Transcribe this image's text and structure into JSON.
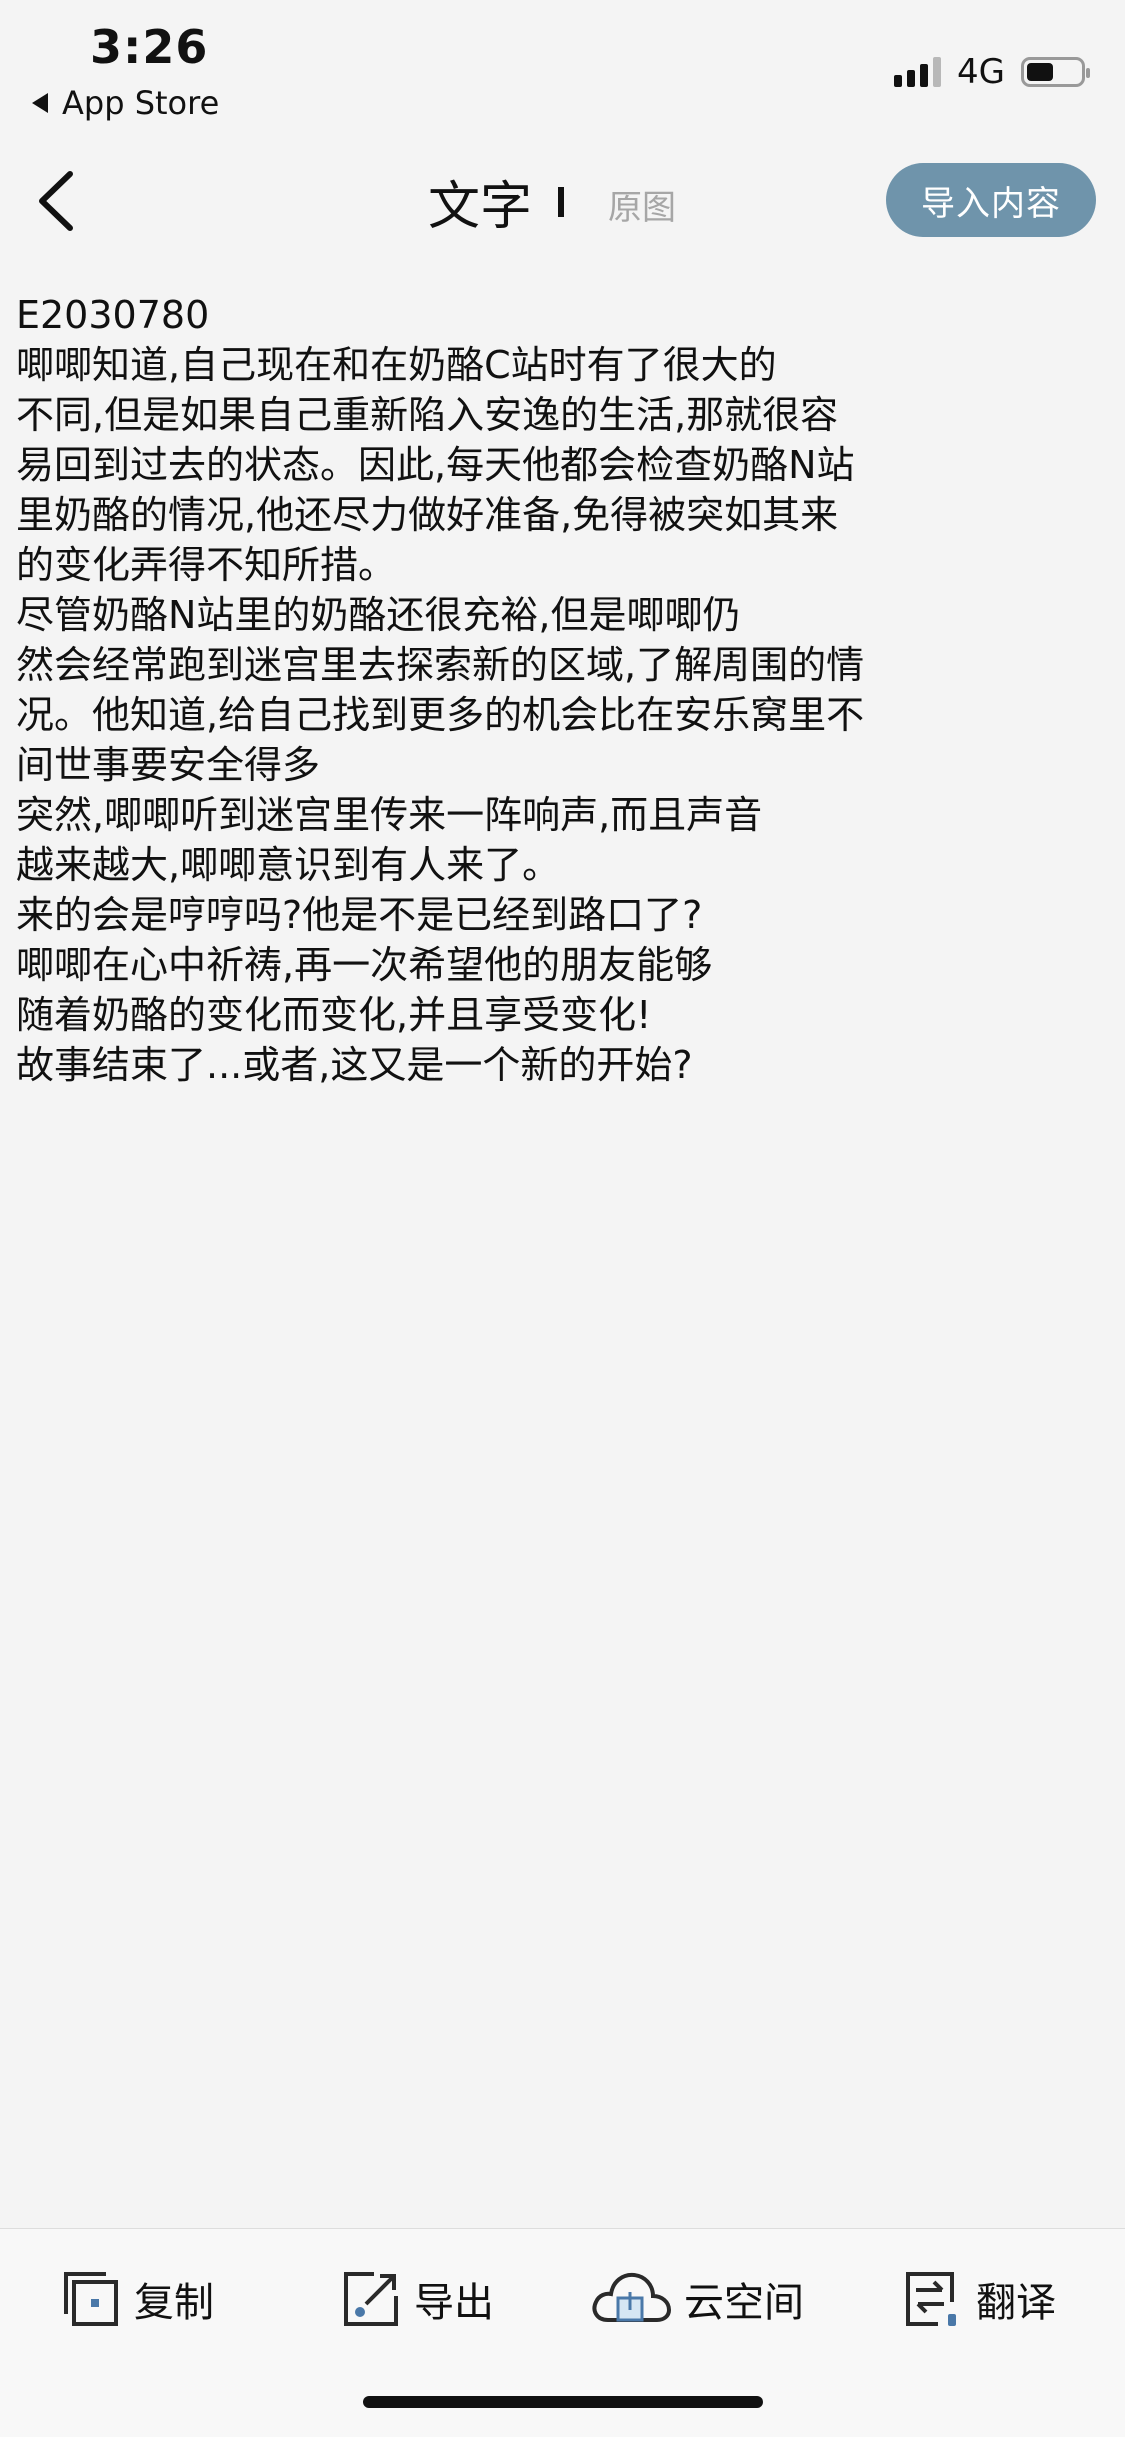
{
  "status_bar": {
    "time": "3:26",
    "back_app": "App Store",
    "network": "4G",
    "battery_level": 0.5
  },
  "nav": {
    "tab_text": "文字",
    "tab_original": "原图",
    "import_label": "导入内容"
  },
  "content": {
    "lines": [
      "E2030780",
      "唧唧知道,自己现在和在奶酪C站时有了很大的",
      "不同,但是如果自己重新陷入安逸的生活,那就很容",
      "易回到过去的状态。因此,每天他都会检查奶酪N站",
      "里奶酪的情况,他还尽力做好准备,免得被突如其来",
      "的变化弄得不知所措。",
      "尽管奶酪N站里的奶酪还很充裕,但是唧唧仍",
      "然会经常跑到迷宫里去探索新的区域,了解周围的情",
      "况。他知道,给自己找到更多的机会比在安乐窝里不",
      "间世事要安全得多",
      "突然,唧唧听到迷宫里传来一阵响声,而且声音",
      "越来越大,唧唧意识到有人来了。",
      "来的会是哼哼吗?他是不是已经到路口了?",
      "唧唧在心中祈祷,再一次希望他的朋友能够",
      "随着奶酪的变化而变化,并且享受变化!",
      "故事结束了...或者,这又是一个新的开始?"
    ]
  },
  "toolbar": {
    "copy_label": "复制",
    "export_label": "导出",
    "cloud_label": "云空间",
    "translate_label": "翻译"
  },
  "icons": {
    "back": "chevron-left-icon",
    "copy": "copy-icon",
    "export": "export-icon",
    "cloud": "cloud-icon",
    "translate": "translate-icon"
  },
  "colors": {
    "accent": "#6f94ab",
    "background": "#f4f4f4",
    "toolbar_background": "#f8f8f8",
    "muted_text": "#a6a6a6"
  }
}
